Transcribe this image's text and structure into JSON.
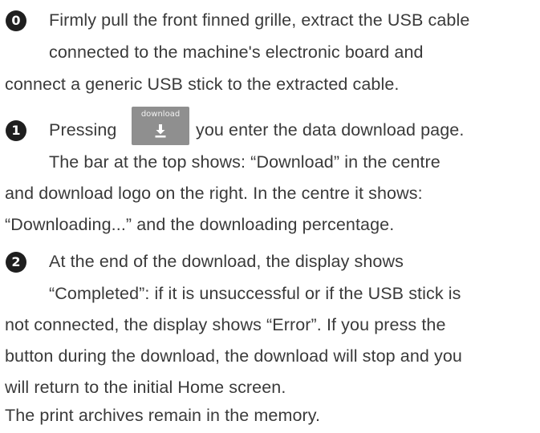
{
  "steps": [
    {
      "number": "0",
      "lines": [
        "Firmly pull the front finned grille, extract the USB cable",
        "connected to the machine's electronic board and",
        "connect a generic USB stick to the extracted cable."
      ]
    },
    {
      "number": "1",
      "intro_before": "Pressing",
      "intro_after": "you enter the data download page.",
      "button_label": "download",
      "button_icon": "download-arrow-icon",
      "lines": [
        "The bar at the top shows: “Download” in the centre",
        "and download logo on the right. In the centre it shows:",
        "“Downloading...” and the downloading percentage."
      ]
    },
    {
      "number": "2",
      "lines": [
        "At the end of the download, the display shows",
        "“Completed”: if it is unsuccessful or if the USB stick is",
        "not connected, the display shows “Error”. If you press the",
        "button during the download, the download will stop and you",
        "will return to the initial Home screen.",
        "The print archives remain in the memory."
      ]
    }
  ],
  "colors": {
    "text": "#3a3a3a",
    "badge": "#1f1f1f",
    "button": "#8f8f8f"
  }
}
